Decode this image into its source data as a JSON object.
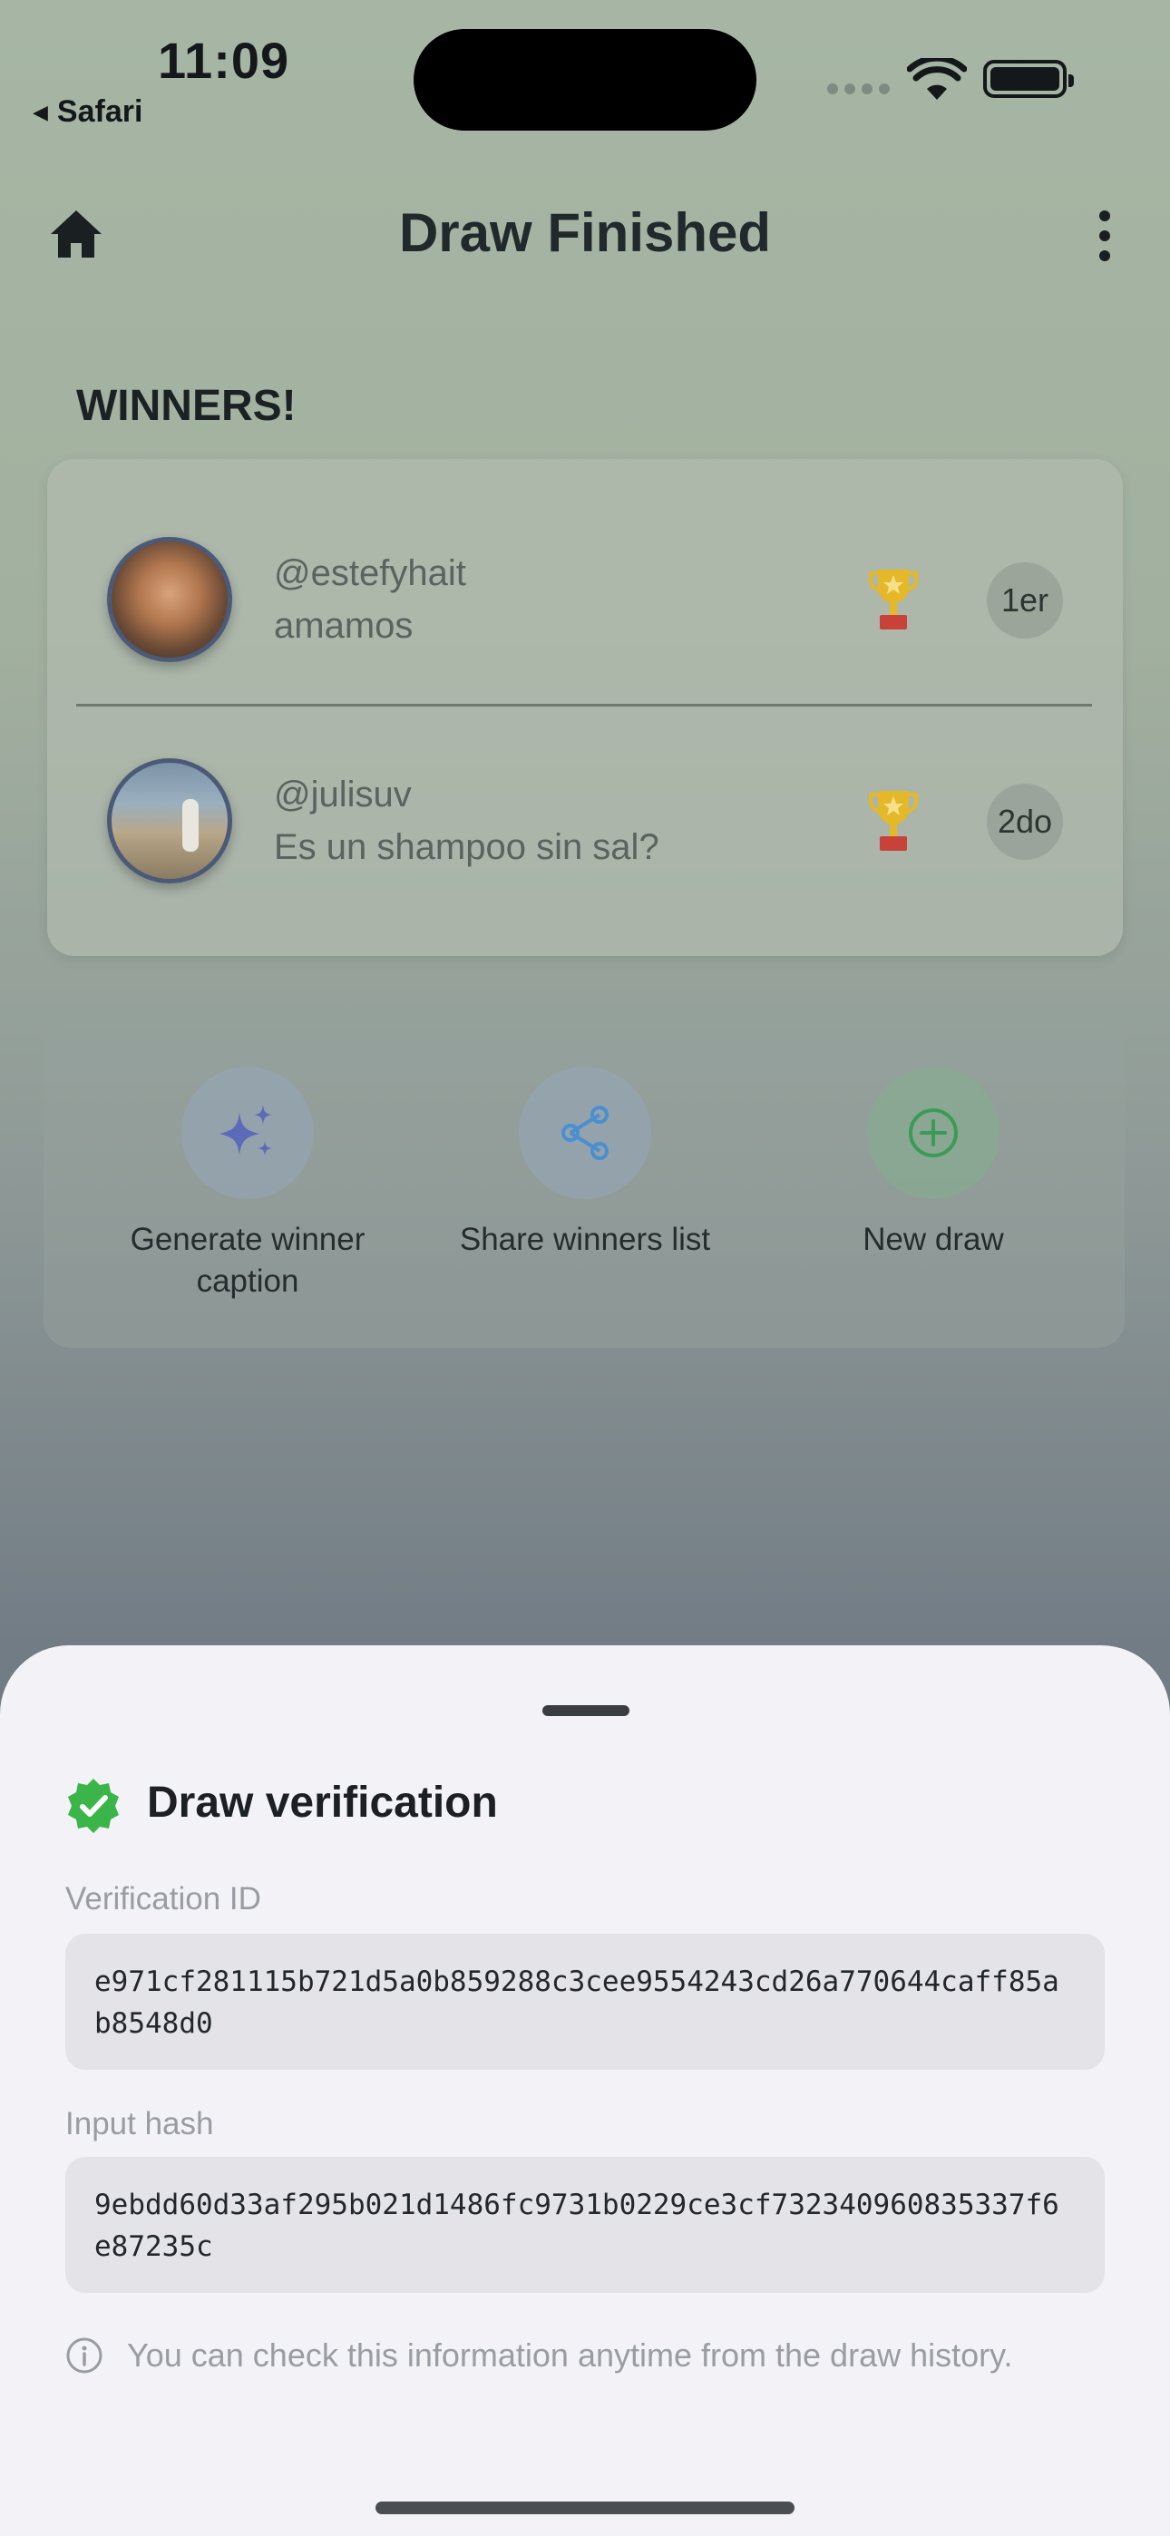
{
  "status_bar": {
    "time": "11:09",
    "back_app": "Safari"
  },
  "header": {
    "title": "Draw Finished",
    "left_icon": "home-icon",
    "right_icon": "more-vertical-icon"
  },
  "winners": {
    "section_title": "WINNERS!",
    "items": [
      {
        "username": "@estefyhait",
        "comment": "amamos",
        "place": "1er",
        "icon": "trophy-icon"
      },
      {
        "username": "@julisuv",
        "comment": "Es un shampoo sin sal?",
        "place": "2do",
        "icon": "trophy-icon"
      }
    ]
  },
  "actions": [
    {
      "label": "Generate winner caption",
      "icon": "sparkles-icon"
    },
    {
      "label": "Share winners list",
      "icon": "share-icon"
    },
    {
      "label": "New draw",
      "icon": "plus-circle-icon"
    }
  ],
  "sheet": {
    "title": "Draw verification",
    "verification_id_label": "Verification ID",
    "verification_id": "e971cf281115b721d5a0b859288c3cee9554243cd26a770644caff85ab8548d0",
    "input_hash_label": "Input hash",
    "input_hash": "9ebdd60d33af295b021d1486fc9731b0229ce3cf732340960835337f6e87235c",
    "info_text": "You can check this information anytime from the draw history."
  },
  "colors": {
    "accent_green": "#3bb54a",
    "icon_blue": "#5b6bb8",
    "share_blue": "#4a8fd0",
    "new_draw_green": "#3c9a56",
    "trophy_gold": "#e5b82a",
    "trophy_red": "#c9423a"
  }
}
